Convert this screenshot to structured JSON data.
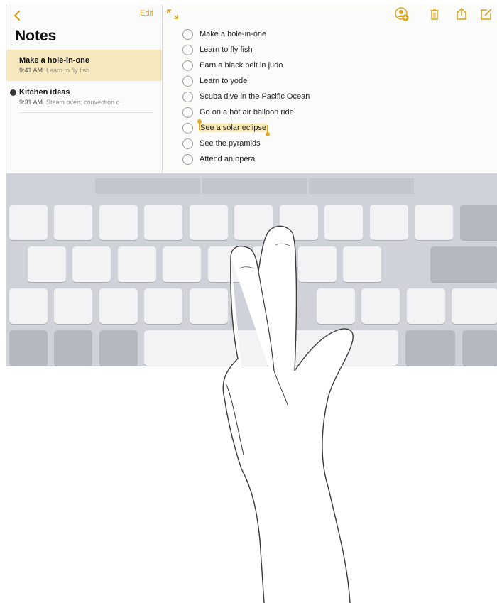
{
  "sidebar": {
    "back_icon": "chevron-left-icon",
    "edit_label": "Edit",
    "title": "Notes",
    "notes": [
      {
        "title": "Make a hole-in-one",
        "time": "9:41 AM",
        "preview": "Learn to fly fish",
        "selected": true
      },
      {
        "title": "Kitchen ideas",
        "time": "9:31 AM",
        "preview": "Steam oven; convection o...",
        "shared": true
      }
    ]
  },
  "toolbar": {
    "expand_icon": "expand-arrows-icon",
    "icons": [
      "add-person-icon",
      "trash-icon",
      "share-icon",
      "compose-icon"
    ]
  },
  "checklist": [
    "Make a hole-in-one",
    "Learn to fly fish",
    "Earn a black belt in judo",
    "Learn to yodel",
    "Scuba dive in the Pacific Ocean",
    "Go on a hot air balloon ride",
    "See a solar eclipse",
    "See the pyramids",
    "Attend an opera"
  ],
  "selected_item": "See a solar eclipse",
  "colors": {
    "accent": "#d9a21b",
    "selection_fill": "#fbe9b4",
    "selected_note_bg": "#f6e8bd",
    "keyboard_bg": "#cfd2d8"
  },
  "gesture": "two-finger-touch-on-keyboard"
}
